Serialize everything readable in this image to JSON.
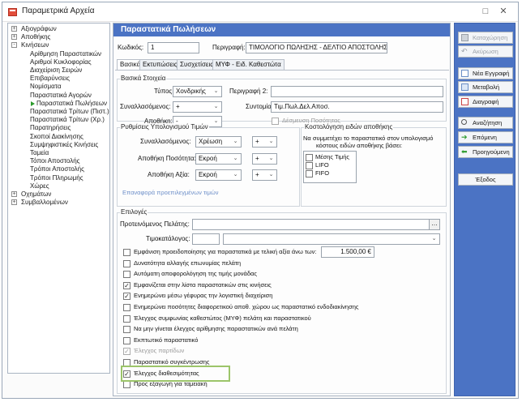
{
  "window": {
    "title": "Παραμετρικά Αρχεία"
  },
  "tree": {
    "items": [
      {
        "label": "Αξιογράφων",
        "level": 0,
        "exp": "+"
      },
      {
        "label": "Αποθήκης",
        "level": 0,
        "exp": "+"
      },
      {
        "label": "Κινήσεων",
        "level": 0,
        "exp": "-"
      },
      {
        "label": "Αρίθμηση Παραστατικών",
        "level": 1
      },
      {
        "label": "Αριθμοί Κυκλοφορίας",
        "level": 1
      },
      {
        "label": "Διαχείριση Σειρών",
        "level": 1
      },
      {
        "label": "Επιβαρύνσεις",
        "level": 1
      },
      {
        "label": "Νομίσματα",
        "level": 1
      },
      {
        "label": "Παραστατικά Αγορών",
        "level": 1
      },
      {
        "label": "Παραστατικά Πωλήσεων",
        "level": 2,
        "selected": true
      },
      {
        "label": "Παραστατικά Τρίτων (Πιστ.)",
        "level": 1
      },
      {
        "label": "Παραστατικά Τρίτων (Χρ.)",
        "level": 1
      },
      {
        "label": "Παρατηρήσεις",
        "level": 1
      },
      {
        "label": "Σκοποί Διακίνησης",
        "level": 1
      },
      {
        "label": "Συμψηφιστικές Κινήσεις",
        "level": 1
      },
      {
        "label": "Ταμεία",
        "level": 1
      },
      {
        "label": "Τόποι Αποστολής",
        "level": 1
      },
      {
        "label": "Τρόποι Αποστολής",
        "level": 1
      },
      {
        "label": "Τρόποι Πληρωμής",
        "level": 1
      },
      {
        "label": "Χώρες",
        "level": 1
      },
      {
        "label": "Οχημάτων",
        "level": 0,
        "exp": "+"
      },
      {
        "label": "Συμβαλλομένων",
        "level": 0,
        "exp": "+"
      }
    ]
  },
  "header": {
    "title": "Παραστατικά Πωλήσεων"
  },
  "code": {
    "label": "Κωδικός:",
    "value": "1"
  },
  "description": {
    "label": "Περιγραφή:",
    "value": "ΤΙΜΟΛΟΓΙΟ ΠΩΛΗΣΗΣ - ΔΕΛΤΙΟ ΑΠΟΣΤΟΛΗΣ"
  },
  "tabs": [
    "Βασικά",
    "Εκτυπώσεις",
    "Συσχετίσεις",
    "ΜΥΦ - Ειδ. Καθεστώτα"
  ],
  "basic": {
    "title": "Βασικά Στοιχεία",
    "type_label": "Τύπος:",
    "type_value": "Χονδρικής",
    "partner_label": "Συναλλασόμενος:",
    "partner_value": "+",
    "warehouse_label": "Αποθήκη:",
    "warehouse_value": "-",
    "desc2_label": "Περιγραφή 2:",
    "desc2_value": "",
    "abbr_label": "Συντομία:",
    "abbr_value": "Τιμ.Πωλ.Δελ.Αποσ.",
    "commit_label": "Δέσμευση Ποσότητας"
  },
  "calc": {
    "title": "Ρυθμίσεις Υπολογισμού Τιμών",
    "partner_label": "Συναλλασόμενος:",
    "partner_value": "Χρέωση",
    "partner_sign": "+",
    "qty_label": "Αποθήκη Ποσότητα:",
    "qty_value": "Εκροή",
    "qty_sign": "+",
    "value_label": "Αποθήκη Αξία:",
    "value_value": "Εκροή",
    "value_sign": "+",
    "restore_link": "Επαναφορά προεπιλεγμένων τιμών"
  },
  "costing": {
    "title": "Κοστολόγηση ειδών αποθήκης",
    "note1": "Να συμμετέχει το παραστατικό στον υπολογισμό",
    "note2": "κόστους ειδών αποθήκης βάσει:",
    "options": [
      "Μέσης Τιμής",
      "LIFO",
      "FIFO"
    ]
  },
  "options": {
    "title": "Επιλογές",
    "default_customer_label": "Προτεινόμενος Πελάτης:",
    "default_customer_value": "",
    "pricelist_label": "Τιμοκατάλογος:",
    "pricelist_value": "",
    "warn_value": "1.500,00 €",
    "checks": [
      {
        "label": "Εμφάνιση προειδοποίησης για παραστατικά με τελική αξία άνω των:",
        "checked": false,
        "dim": false
      },
      {
        "label": "Δυνατότητα αλλαγής επωνυμίας πελάτη",
        "checked": false,
        "dim": false
      },
      {
        "label": "Αυτόματη αποφορολόγηση της τιμής μονάδας",
        "checked": false,
        "dim": false
      },
      {
        "label": "Εμφανίζεται στην λίστα παραστατικών στις κινήσεις",
        "checked": true,
        "dim": false
      },
      {
        "label": "Ενημερώνει μέσω γέφυρας την λογιστική διαχείριση",
        "checked": true,
        "dim": false
      },
      {
        "label": "Ενημερώνει ποσότητες διαφορετικού αποθ. χώρου ως παραστατικό ενδοδιακίνησης",
        "checked": false,
        "dim": false
      },
      {
        "label": "Έλεγχος συμφωνίας καθεστώτος (ΜΥΦ) πελάτη και παραστατικού",
        "checked": false,
        "dim": false
      },
      {
        "label": "Να μην γίνεται έλεγχος αρίθμησης παραστατικών ανά πελάτη",
        "checked": false,
        "dim": false
      },
      {
        "label": "Εκπτωτικό παραστατικό",
        "checked": false,
        "dim": false
      },
      {
        "label": "Έλεγχος παρτίδων",
        "checked": true,
        "dim": true
      },
      {
        "label": "Παραστατικό συγκέντρωσης",
        "checked": false,
        "dim": false
      },
      {
        "label": "Έλεγχος διαθεσιμότητας",
        "checked": true,
        "dim": false
      },
      {
        "label": "Προς εξαγωγή για ταμειακή",
        "checked": false,
        "dim": false
      }
    ]
  },
  "actions": {
    "save": "Καταχώρηση",
    "cancel": "Ακύρωση",
    "new": "Νέα Εγγραφή",
    "edit": "Μεταβολή",
    "delete": "Διαγραφή",
    "search": "Αναζήτηση",
    "next": "Επόμενη",
    "prev": "Προηγούμενη",
    "exit": "Έξοδος"
  }
}
